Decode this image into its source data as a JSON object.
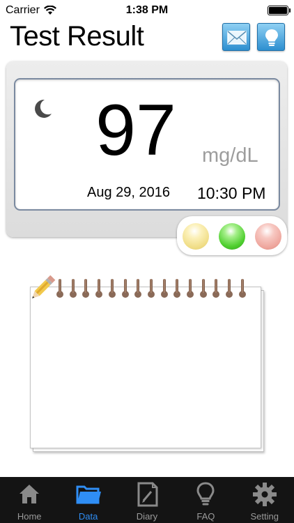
{
  "status_bar": {
    "carrier": "Carrier",
    "time": "1:38 PM"
  },
  "header": {
    "title": "Test Result",
    "mail_icon": "envelope-icon",
    "tip_icon": "lightbulb-icon"
  },
  "result": {
    "value": "97",
    "unit": "mg/dL",
    "date": "Aug 29, 2016",
    "time": "10:30 PM",
    "meal_icon": "moon-icon",
    "indicators": {
      "yellow": "#f0dd86",
      "green": "#4fcf2f",
      "red": "#eea59c"
    }
  },
  "notepad": {
    "icon": "pencil-icon"
  },
  "tabs": [
    {
      "label": "Home",
      "icon": "home-icon"
    },
    {
      "label": "Data",
      "icon": "folder-icon",
      "active": true
    },
    {
      "label": "Diary",
      "icon": "diary-icon"
    },
    {
      "label": "FAQ",
      "icon": "lightbulb-icon"
    },
    {
      "label": "Setting",
      "icon": "gear-icon"
    }
  ],
  "colors": {
    "tab_active": "#2f8ef5",
    "tab_inactive": "#9a9a9a",
    "unit_gray": "#9d9d9d"
  }
}
